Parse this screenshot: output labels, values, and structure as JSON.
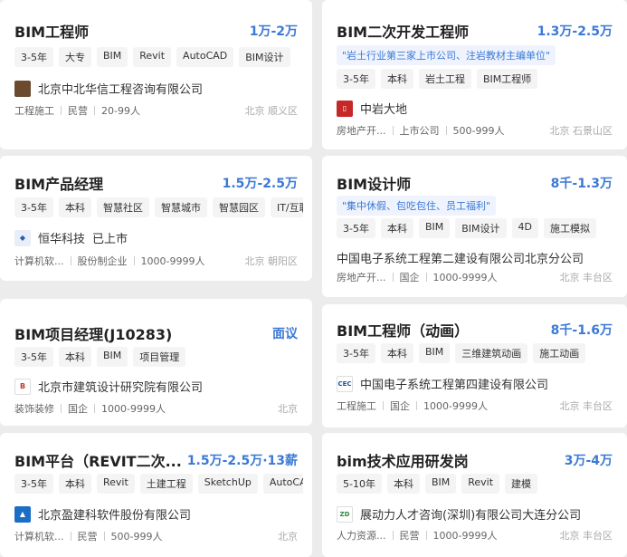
{
  "colors": {
    "accent": "#3b79d6",
    "background": "#ececec",
    "card": "#ffffff"
  },
  "jobs": [
    {
      "title": "BIM工程师",
      "salary": "1万-2万",
      "tags": [
        "3-5年",
        "大专",
        "BIM",
        "Revit",
        "AutoCAD",
        "BIM设计"
      ],
      "company": "北京中北华信工程咨询有限公司",
      "logo_icon": "company-logo-icon",
      "meta": [
        "工程施工",
        "民营",
        "20-99人"
      ],
      "location": "北京 顺义区"
    },
    {
      "title": "BIM产品经理",
      "salary": "1.5万-2.5万",
      "tags": [
        "3-5年",
        "本科",
        "智慧社区",
        "智慧城市",
        "智慧园区",
        "IT/互联网"
      ],
      "company": "恒华科技",
      "company_badge": "已上市",
      "logo_icon": "company-logo-icon",
      "meta": [
        "计算机软...",
        "股份制企业",
        "1000-9999人"
      ],
      "location": "北京 朝阳区"
    },
    {
      "title": "BIM项目经理(J10283)",
      "salary": "面议",
      "tags": [
        "3-5年",
        "本科",
        "BIM",
        "项目管理"
      ],
      "company": "北京市建筑设计研究院有限公司",
      "logo_icon": "company-logo-icon",
      "meta": [
        "装饰装修",
        "国企",
        "1000-9999人"
      ],
      "location": "北京"
    },
    {
      "title": "BIM平台（REVIT二次...",
      "salary": "1.5万-2.5万·13薪",
      "tags": [
        "3-5年",
        "本科",
        "Revit",
        "土建工程",
        "SketchUp",
        "AutoCAD"
      ],
      "company": "北京盈建科软件股份有限公司",
      "logo_icon": "company-logo-icon",
      "meta": [
        "计算机软...",
        "民营",
        "500-999人"
      ],
      "location": "北京"
    },
    {
      "title": "BIM二次开发工程师",
      "salary": "1.3万-2.5万",
      "highlight": "\"岩土行业第三家上市公司、注岩教材主编单位\"",
      "tags": [
        "3-5年",
        "本科",
        "岩土工程",
        "BIM工程师"
      ],
      "company": "中岩大地",
      "logo_icon": "company-logo-icon",
      "meta": [
        "房地产开...",
        "上市公司",
        "500-999人"
      ],
      "location": "北京 石景山区"
    },
    {
      "title": "BIM设计师",
      "salary": "8千-1.3万",
      "highlight": "\"集中休假、包吃包住、员工福利\"",
      "tags": [
        "3-5年",
        "本科",
        "BIM",
        "BIM设计",
        "4D",
        "施工模拟"
      ],
      "company": "中国电子系统工程第二建设有限公司北京分公司",
      "meta": [
        "房地产开...",
        "国企",
        "1000-9999人"
      ],
      "location": "北京 丰台区"
    },
    {
      "title": "BIM工程师（动画）",
      "salary": "8千-1.6万",
      "tags": [
        "3-5年",
        "本科",
        "BIM",
        "三维建筑动画",
        "施工动画"
      ],
      "company": "中国电子系统工程第四建设有限公司",
      "logo_icon": "company-logo-icon",
      "meta": [
        "工程施工",
        "国企",
        "1000-9999人"
      ],
      "location": "北京 丰台区"
    },
    {
      "title": "bim技术应用研发岗",
      "salary": "3万-4万",
      "tags": [
        "5-10年",
        "本科",
        "BIM",
        "Revit",
        "建模"
      ],
      "company": "展动力人才咨询(深圳)有限公司大连分公司",
      "logo_icon": "company-logo-icon",
      "meta": [
        "人力资源...",
        "民营",
        "1000-9999人"
      ],
      "location": "北京 丰台区"
    }
  ]
}
